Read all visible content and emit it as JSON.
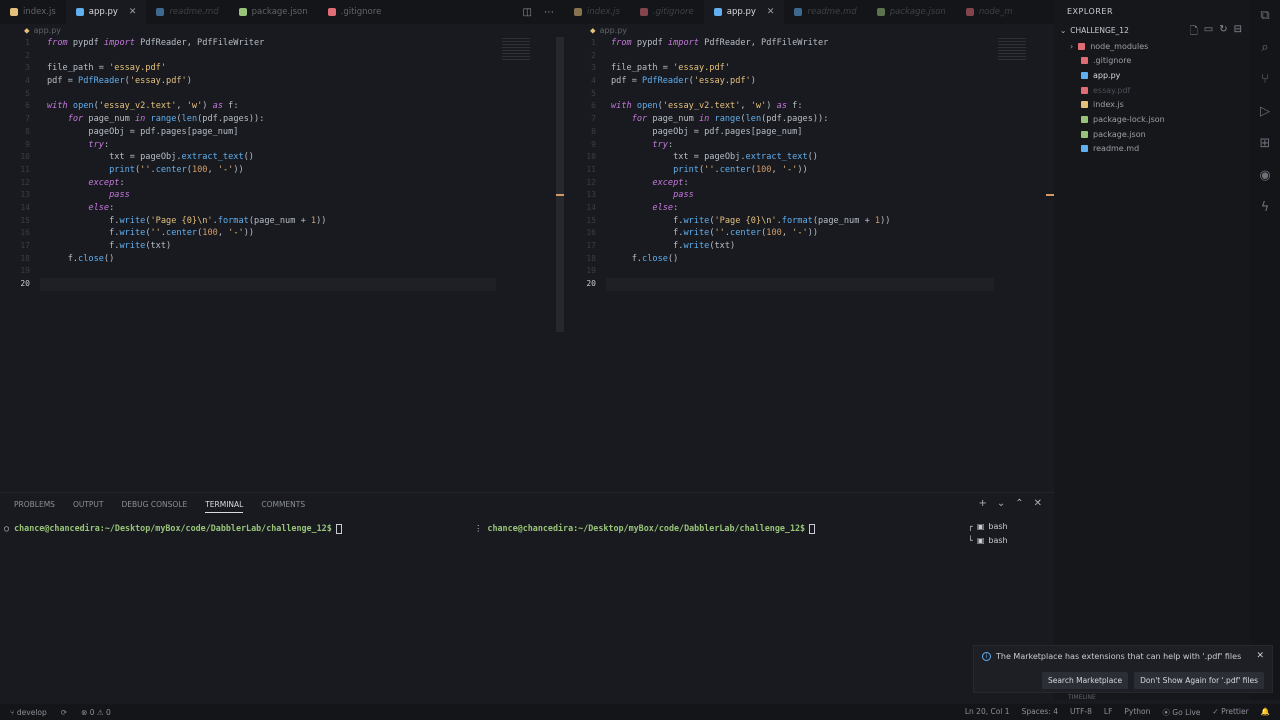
{
  "left_tabs": [
    {
      "label": "index.js",
      "color": "#e5c07b",
      "state": "normal"
    },
    {
      "label": "app.py",
      "color": "#61afef",
      "state": "active"
    },
    {
      "label": "readme.md",
      "color": "#61afef",
      "state": "dim"
    },
    {
      "label": "package.json",
      "color": "#98c379",
      "state": "normal"
    },
    {
      "label": ".gitignore",
      "color": "#e06c75",
      "state": "normal"
    }
  ],
  "right_tabs": [
    {
      "label": "index.js",
      "color": "#e5c07b",
      "state": "dim"
    },
    {
      "label": ".gitignore",
      "color": "#e06c75",
      "state": "dim"
    },
    {
      "label": "app.py",
      "color": "#61afef",
      "state": "active"
    },
    {
      "label": "readme.md",
      "color": "#61afef",
      "state": "dim"
    },
    {
      "label": "package.json",
      "color": "#98c379",
      "state": "dim"
    },
    {
      "label": "node_m",
      "color": "#e06c75",
      "state": "dim"
    }
  ],
  "breadcrumb": "app.py",
  "code_lines": [
    "<span class=\"kw\">from</span> pypdf <span class=\"kw\">import</span> PdfReader, PdfFileWriter",
    "",
    "file_path = <span class=\"str\">'essay.pdf'</span>",
    "pdf = <span class=\"fn\">PdfReader</span>(<span class=\"str\">'essay.pdf'</span>)",
    "",
    "<span class=\"kw\">with</span> <span class=\"fn\">open</span>(<span class=\"str\">'essay_v2.text'</span>, <span class=\"str\">'w'</span>) <span class=\"kw\">as</span> f:",
    "    <span class=\"kw\">for</span> page_num <span class=\"kw\">in</span> <span class=\"fn\">range</span>(<span class=\"fn\">len</span>(pdf.pages)):",
    "        pageObj = pdf.pages[page_num]",
    "        <span class=\"kw\">try</span>:",
    "            txt = pageObj.<span class=\"fn\">extract_text</span>()",
    "            <span class=\"fn\">print</span>(<span class=\"str\">''</span>.<span class=\"fn\">center</span>(<span class=\"num\">100</span>, <span class=\"str\">'-'</span>))",
    "        <span class=\"kw\">except</span>:",
    "            <span class=\"kw\">pass</span>",
    "        <span class=\"kw\">else</span>:",
    "            f.<span class=\"fn\">write</span>(<span class=\"str\">'Page {0}\\n'</span>.<span class=\"fn\">format</span>(page_num + <span class=\"num\">1</span>))",
    "            f.<span class=\"fn\">write</span>(<span class=\"str\">''</span>.<span class=\"fn\">center</span>(<span class=\"num\">100</span>, <span class=\"str\">'-'</span>))",
    "            f.<span class=\"fn\">write</span>(txt)",
    "    f.<span class=\"fn\">close</span>()",
    "",
    ""
  ],
  "current_line": 20,
  "explorer": {
    "title": "EXPLORER",
    "project": "CHALLENGE_12",
    "files": [
      {
        "name": "node_modules",
        "color": "#e06c75",
        "text_color": "#9aa0a6",
        "indent": 0,
        "folder": true
      },
      {
        "name": ".gitignore",
        "color": "#e06c75",
        "text_color": "#9aa0a6",
        "indent": 1,
        "folder": false
      },
      {
        "name": "app.py",
        "color": "#61afef",
        "text_color": "#d7dae0",
        "indent": 1,
        "folder": false
      },
      {
        "name": "essay.pdf",
        "color": "#e06c75",
        "text_color": "#4b4f57",
        "indent": 1,
        "folder": false
      },
      {
        "name": "index.js",
        "color": "#e5c07b",
        "text_color": "#9aa0a6",
        "indent": 1,
        "folder": false
      },
      {
        "name": "package-lock.json",
        "color": "#98c379",
        "text_color": "#9aa0a6",
        "indent": 1,
        "folder": false
      },
      {
        "name": "package.json",
        "color": "#98c379",
        "text_color": "#9aa0a6",
        "indent": 1,
        "folder": false
      },
      {
        "name": "readme.md",
        "color": "#61afef",
        "text_color": "#9aa0a6",
        "indent": 1,
        "folder": false
      }
    ]
  },
  "panel": {
    "tabs": [
      "PROBLEMS",
      "OUTPUT",
      "DEBUG CONSOLE",
      "TERMINAL",
      "COMMENTS"
    ],
    "active_tab": "TERMINAL",
    "prompt_left": "chance@chancedira:~/Desktop/myBox/code/DabblerLab/challenge_12$",
    "prompt_right": "chance@chancedira:~/Desktop/myBox/code/DabblerLab/challenge_12$",
    "terminals": [
      "bash",
      "bash"
    ]
  },
  "notification": {
    "message": "The Marketplace has extensions that can help with '.pdf' files",
    "btn_search": "Search Marketplace",
    "btn_dismiss": "Don't Show Again for '.pdf' files"
  },
  "timeline_label": "TIMELINE",
  "status": {
    "branch": "develop",
    "errors": "0",
    "warnings": "0",
    "position": "Ln 20, Col 1",
    "spaces": "Spaces: 4",
    "encoding": "UTF-8",
    "eol": "LF",
    "language": "Python",
    "golive": "Go Live",
    "prettier": "Prettier"
  }
}
